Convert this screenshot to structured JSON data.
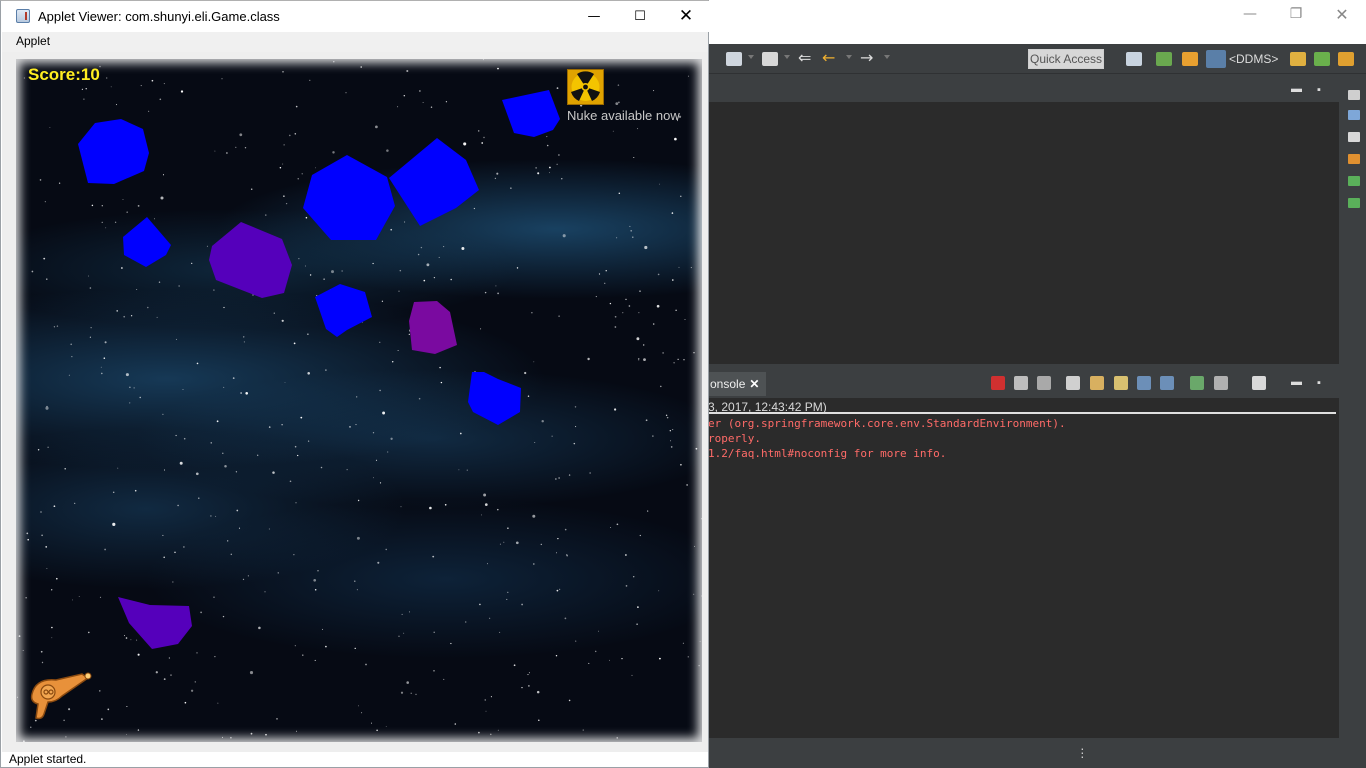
{
  "applet": {
    "title": "Applet Viewer: com.shunyi.eli.Game.class",
    "menu": [
      "Applet"
    ],
    "status": "Applet started.",
    "controls": {
      "minimize": "—",
      "maximize": "☐",
      "close": "✕"
    }
  },
  "game": {
    "score": "Score:10",
    "nuke_label": "Nuke available now",
    "colors": {
      "asteroid_blue": "#0000ff",
      "asteroid_purple": "#5500bb",
      "asteroid_violet": "#7a0aa0",
      "score": "#ffee22"
    }
  },
  "eclipse": {
    "controls": {
      "minimize": "—",
      "restore": "❐",
      "close": "✕"
    },
    "toolbar": {
      "quick_access": "Quick Access",
      "perspective": "<DDMS>"
    },
    "console": {
      "tab_label": "onsole",
      "header": "3, 2017, 12:43:42 PM)",
      "lines": [
        "er (org.springframework.core.env.StandardEnvironment).",
        "roperly.",
        "1.2/faq.html#noconfig for more info."
      ]
    }
  }
}
